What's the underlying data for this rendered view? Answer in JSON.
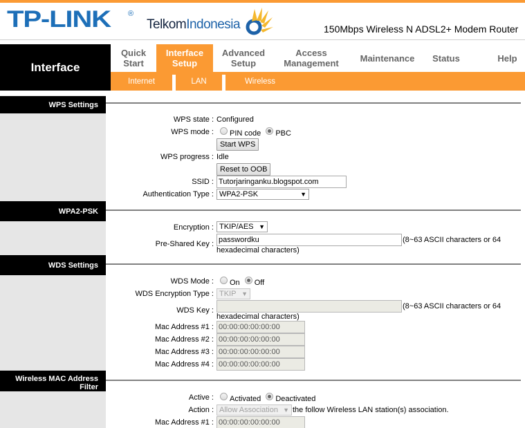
{
  "header": {
    "brand": "TP-LINK",
    "brand_registered": "®",
    "partner_word1": "Telkom",
    "partner_word2": "Indonesia",
    "product_title": "150Mbps Wireless N ADSL2+ Modem Router",
    "accent_color": "#fb9a33"
  },
  "nav": {
    "section_label": "Interface",
    "tabs": [
      {
        "label_line1": "Quick",
        "label_line2": "Start",
        "active": false
      },
      {
        "label_line1": "Interface",
        "label_line2": "Setup",
        "active": true
      },
      {
        "label_line1": "Advanced",
        "label_line2": "Setup",
        "active": false
      },
      {
        "label_line1": "Access",
        "label_line2": "Management",
        "active": false
      },
      {
        "label_line1": "Maintenance",
        "label_line2": "",
        "active": false
      },
      {
        "label_line1": "Status",
        "label_line2": "",
        "active": false
      },
      {
        "label_line1": "Help",
        "label_line2": "",
        "active": false
      }
    ],
    "subtabs": [
      {
        "label": "Internet"
      },
      {
        "label": "LAN"
      },
      {
        "label": "Wireless"
      }
    ]
  },
  "wps": {
    "heading": "WPS Settings",
    "state_label": "WPS state :",
    "state_value": "Configured",
    "mode_label": "WPS mode :",
    "mode_options": [
      "PIN code",
      "PBC"
    ],
    "mode_selected": "PBC",
    "start_button": "Start WPS",
    "progress_label": "WPS progress :",
    "progress_value": "Idle",
    "reset_button": "Reset to OOB",
    "ssid_label": "SSID :",
    "ssid_value": "Tutorjaringanku.blogspot.com",
    "auth_label": "Authentication Type :",
    "auth_value": "WPA2-PSK"
  },
  "wpa2": {
    "heading": "WPA2-PSK",
    "encryption_label": "Encryption :",
    "encryption_value": "TKIP/AES",
    "psk_label": "Pre-Shared Key :",
    "psk_value": "passwordku",
    "psk_hint_line1": "(8~63 ASCII characters or 64",
    "psk_hint_line2": "hexadecimal characters)"
  },
  "wds": {
    "heading": "WDS Settings",
    "mode_label": "WDS Mode :",
    "mode_options": [
      "On",
      "Off"
    ],
    "mode_selected": "Off",
    "enc_label": "WDS Encryption Type :",
    "enc_value": "TKIP",
    "key_label": "WDS Key :",
    "key_value": "",
    "key_hint_line1": "(8~63 ASCII characters or 64",
    "key_hint_line2": "hexadecimal characters)",
    "macs": [
      {
        "label": "Mac Address #1 :",
        "value": "00:00:00:00:00:00"
      },
      {
        "label": "Mac Address #2 :",
        "value": "00:00:00:00:00:00"
      },
      {
        "label": "Mac Address #3 :",
        "value": "00:00:00:00:00:00"
      },
      {
        "label": "Mac Address #4 :",
        "value": "00:00:00:00:00:00"
      }
    ]
  },
  "macfilter": {
    "heading_line1": "Wireless MAC Address",
    "heading_line2": "Filter",
    "active_label": "Active :",
    "active_options": [
      "Activated",
      "Deactivated"
    ],
    "active_selected": "Deactivated",
    "action_label": "Action :",
    "action_value": "Allow Association",
    "action_suffix": "the follow Wireless LAN station(s) association.",
    "mac1_label": "Mac Address #1 :",
    "mac1_value": "00:00:00:00:00:00"
  }
}
